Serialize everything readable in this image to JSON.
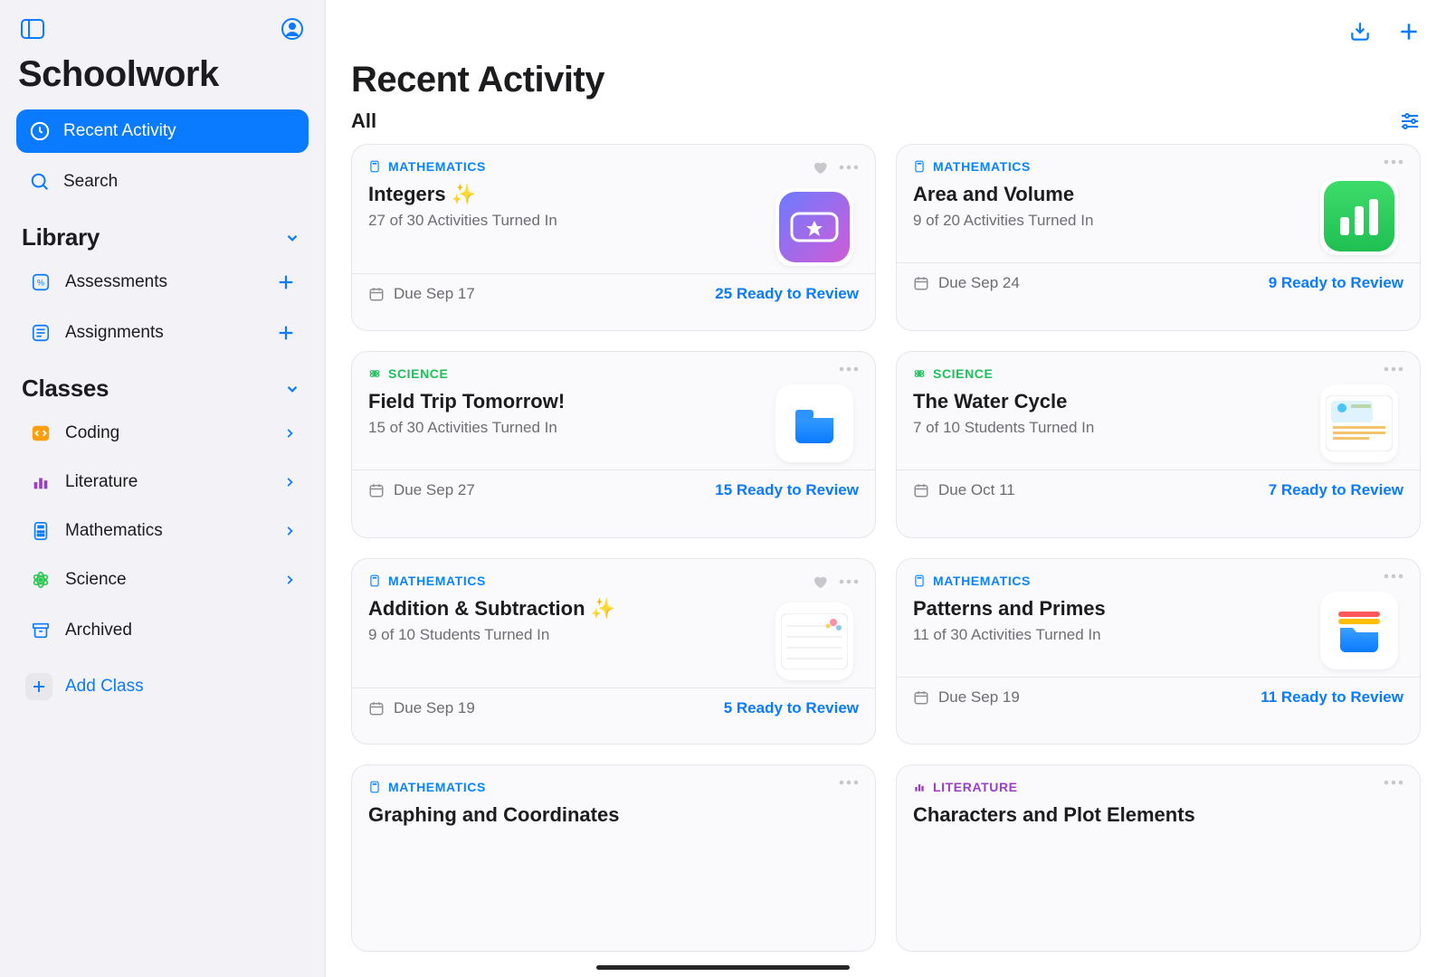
{
  "app": {
    "title": "Schoolwork"
  },
  "nav": {
    "recent": "Recent Activity",
    "search": "Search"
  },
  "sections": {
    "library": "Library",
    "classes": "Classes"
  },
  "library": {
    "assessments": "Assessments",
    "assignments": "Assignments"
  },
  "classes": [
    {
      "id": "coding",
      "label": "Coding",
      "color": "#ff9f0a",
      "glyph": "code"
    },
    {
      "id": "literature",
      "label": "Literature",
      "color": "#9a3fc4",
      "glyph": "bars"
    },
    {
      "id": "mathematics",
      "label": "Mathematics",
      "color": "#0a7aff",
      "glyph": "calc"
    },
    {
      "id": "science",
      "label": "Science",
      "color": "#30c954",
      "glyph": "atom"
    }
  ],
  "archived_label": "Archived",
  "add_class_label": "Add Class",
  "page": {
    "title": "Recent Activity",
    "filter_label": "All"
  },
  "colors": {
    "blue": "#0a7aff",
    "green": "#30c954",
    "purple": "#9a3fc4",
    "orange": "#ff9f0a"
  },
  "cards": [
    {
      "subject": "MATHEMATICS",
      "subject_kind": "math",
      "favorite": true,
      "title": "Integers ✨",
      "status": "27 of 30 Activities Turned In",
      "due": "Due Sep 17",
      "ready": "25 Ready to Review",
      "thumb": "ticket"
    },
    {
      "subject": "MATHEMATICS",
      "subject_kind": "math",
      "favorite": false,
      "title": "Area and Volume",
      "status": "9 of 20 Activities Turned In",
      "due": "Due Sep 24",
      "ready": "9 Ready to Review",
      "thumb": "numbers"
    },
    {
      "subject": "SCIENCE",
      "subject_kind": "sci",
      "favorite": false,
      "title": "Field Trip Tomorrow!",
      "status": "15 of 30 Activities Turned In",
      "due": "Due Sep 27",
      "ready": "15 Ready to Review",
      "thumb": "files-blue"
    },
    {
      "subject": "SCIENCE",
      "subject_kind": "sci",
      "favorite": false,
      "title": "The Water Cycle",
      "status": "7 of 10 Students Turned In",
      "due": "Due Oct 11",
      "ready": "7 Ready to Review",
      "thumb": "doc"
    },
    {
      "subject": "MATHEMATICS",
      "subject_kind": "math",
      "favorite": true,
      "title": "Addition & Subtraction ✨",
      "status": "9 of 10 Students Turned In",
      "due": "Due Sep 19",
      "ready": "5 Ready to Review",
      "thumb": "sheet"
    },
    {
      "subject": "MATHEMATICS",
      "subject_kind": "math",
      "favorite": false,
      "title": "Patterns and Primes",
      "status": "11 of 30 Activities Turned In",
      "due": "Due Sep 19",
      "ready": "11 Ready to Review",
      "thumb": "files-color"
    },
    {
      "subject": "MATHEMATICS",
      "subject_kind": "math",
      "favorite": false,
      "title": "Graphing and Coordinates",
      "status": "",
      "due": "",
      "ready": "",
      "thumb": "none",
      "partial": true
    },
    {
      "subject": "LITERATURE",
      "subject_kind": "lit",
      "favorite": false,
      "title": "Characters and Plot Elements",
      "status": "",
      "due": "",
      "ready": "",
      "thumb": "none",
      "partial": true
    }
  ]
}
